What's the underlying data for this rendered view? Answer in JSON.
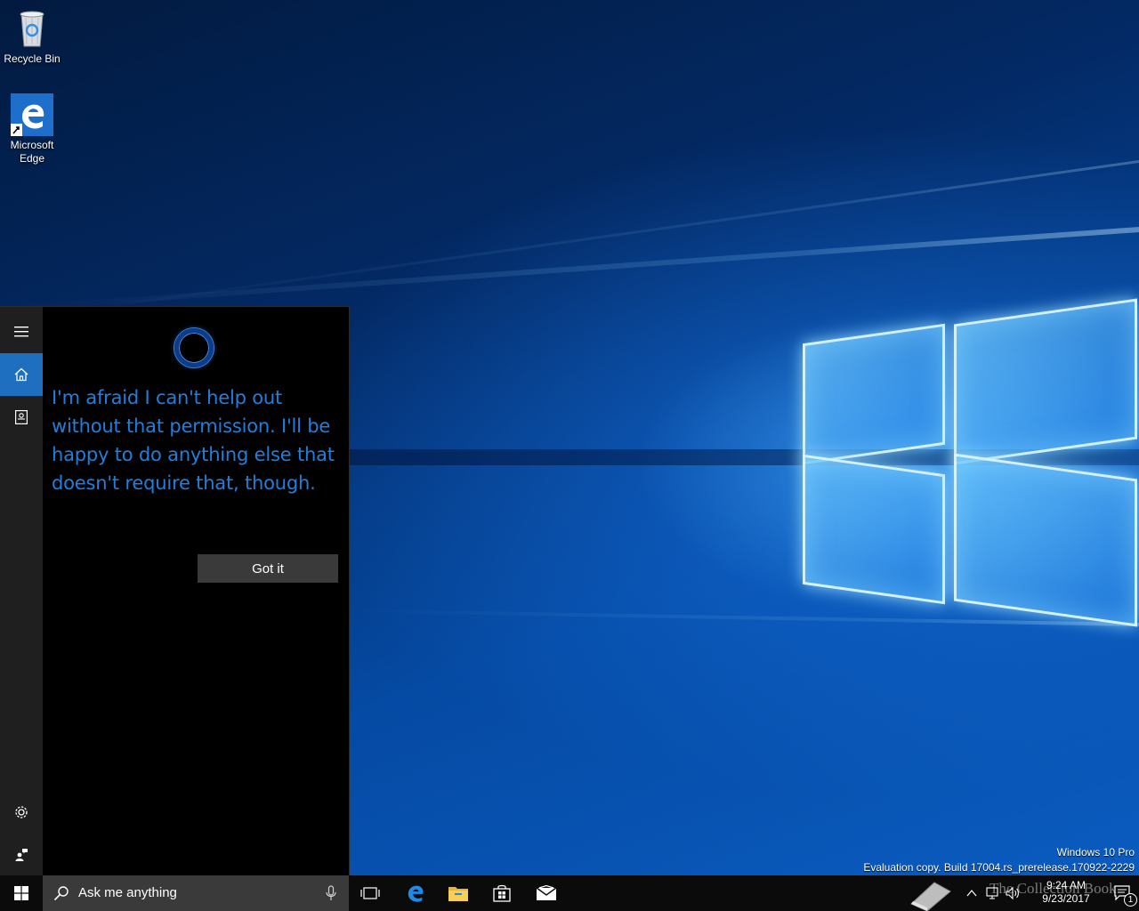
{
  "desktop": {
    "icons": [
      {
        "label": "Recycle Bin",
        "icon": "recycle-bin-icon"
      },
      {
        "label": "Microsoft Edge",
        "icon": "edge-icon"
      }
    ]
  },
  "cortana": {
    "rail": {
      "menu_icon": "hamburger-menu-icon",
      "home_icon": "home-icon",
      "notebook_icon": "notebook-icon",
      "settings_icon": "gear-icon",
      "feedback_icon": "feedback-icon"
    },
    "message": "I'm afraid I can't help out without that permission. I'll be happy to do anything else that doesn't require that, though.",
    "button_label": "Got it"
  },
  "watermark": {
    "edition": "Windows 10 Pro",
    "build": "Evaluation copy. Build 17004.rs_prerelease.170922-2229"
  },
  "taskbar": {
    "search_placeholder": "Ask me anything",
    "pinned": [
      "task-view-icon",
      "edge-icon",
      "file-explorer-icon",
      "store-icon",
      "mail-icon"
    ],
    "overlay_text": "The Collection Book",
    "time": "9:24 AM",
    "date": "9/23/2017",
    "notification_count": "1"
  },
  "colors": {
    "accent": "#1e6fbf",
    "cortana_text": "#1f7fe0",
    "taskbar": "#0b0b0b",
    "search_box": "#3a3a3a"
  }
}
